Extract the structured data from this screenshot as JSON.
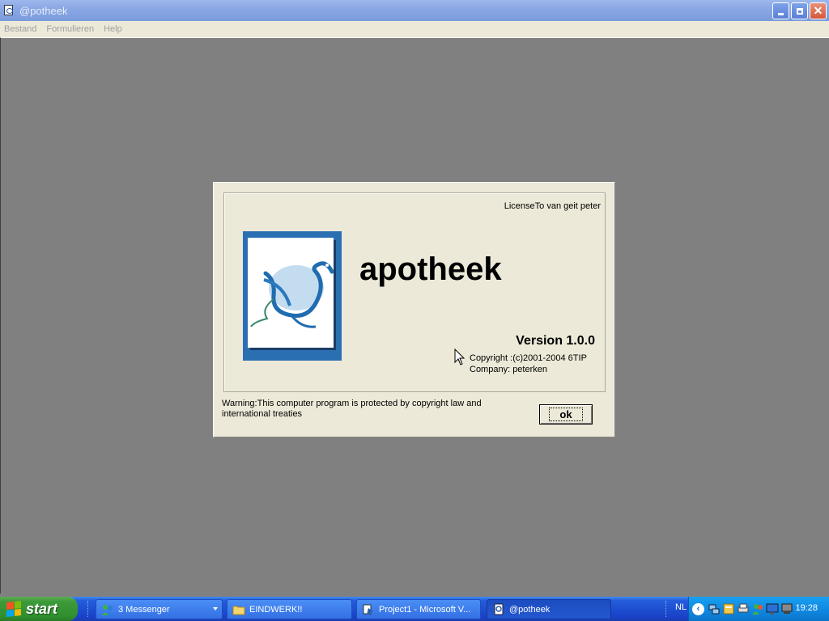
{
  "window": {
    "title": "@potheek",
    "controls": {
      "minimize": "minimize",
      "restore": "restore",
      "close": "close"
    }
  },
  "menu": {
    "items": [
      "Bestand",
      "Formulieren",
      "Help"
    ]
  },
  "splash": {
    "license": "LicenseTo van geit peter",
    "product": "apotheek",
    "version": "Version 1.0.0",
    "copyright": "Copyright :(c)2001-2004 6TIP",
    "company": "Company: peterken",
    "warning": "Warning:This computer program is protected by copyright law and international treaties",
    "ok_label": "ok"
  },
  "taskbar": {
    "start_label": "start",
    "buttons": [
      {
        "label": "3 Messenger",
        "icon": "messenger-icon"
      },
      {
        "label": "EINDWERK!!",
        "icon": "folder-icon"
      },
      {
        "label": "Project1 - Microsoft V...",
        "icon": "vb-icon"
      },
      {
        "label": "@potheek",
        "icon": "app-icon"
      }
    ],
    "language": "NL",
    "clock": "19:28"
  },
  "colors": {
    "desktop": "#808080",
    "dialog": "#ece9d8",
    "taskbar": "#245edb",
    "start": "#3c9a3a",
    "accent": "#2b6fb3"
  }
}
